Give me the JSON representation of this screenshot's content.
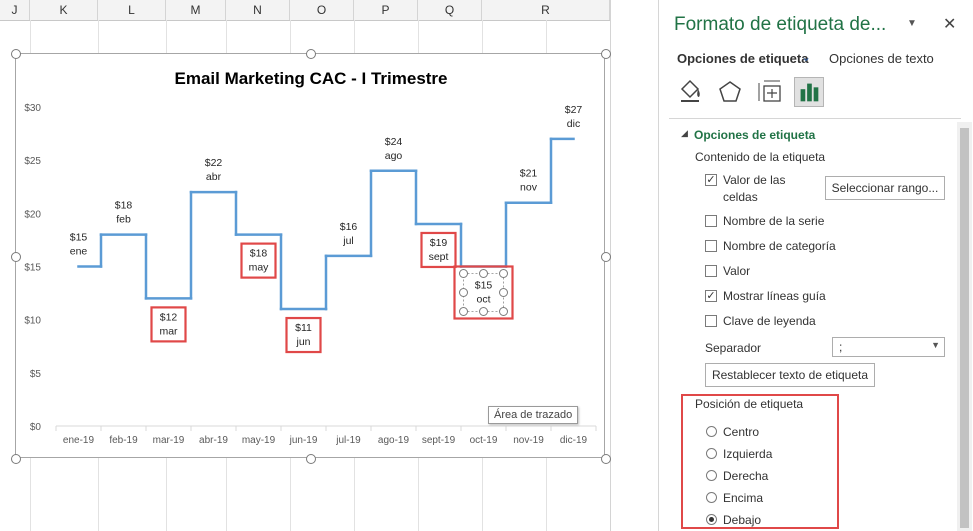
{
  "sheet": {
    "columns": [
      "J",
      "K",
      "L",
      "M",
      "N",
      "O",
      "P",
      "Q",
      "R"
    ]
  },
  "tooltip": "Área de trazado",
  "chart_data": {
    "type": "line",
    "title": "Email Marketing CAC - I Trimestre",
    "categories": [
      "ene-19",
      "feb-19",
      "mar-19",
      "abr-19",
      "may-19",
      "jun-19",
      "jul-19",
      "ago-19",
      "sept-19",
      "oct-19",
      "nov-19",
      "dic-19"
    ],
    "values": [
      15,
      18,
      12,
      22,
      18,
      11,
      16,
      24,
      19,
      15,
      21,
      27
    ],
    "data_labels": [
      {
        "value": "$15",
        "name": "ene"
      },
      {
        "value": "$18",
        "name": "feb"
      },
      {
        "value": "$12",
        "name": "mar"
      },
      {
        "value": "$22",
        "name": "abr"
      },
      {
        "value": "$18",
        "name": "may"
      },
      {
        "value": "$11",
        "name": "jun"
      },
      {
        "value": "$16",
        "name": "jul"
      },
      {
        "value": "$24",
        "name": "ago"
      },
      {
        "value": "$19",
        "name": "sept"
      },
      {
        "value": "$15",
        "name": "oct"
      },
      {
        "value": "$21",
        "name": "nov"
      },
      {
        "value": "$27",
        "name": "dic"
      }
    ],
    "boxed_labels": [
      2,
      4,
      5,
      8,
      9
    ],
    "selected_label": 9,
    "step": true,
    "yticks": [
      "$0",
      "$5",
      "$10",
      "$15",
      "$20",
      "$25",
      "$30"
    ],
    "ylim": [
      0,
      30
    ],
    "grid": false,
    "line_color": "#5b9bd5",
    "highlight_color": "#e04848"
  },
  "pane": {
    "title": "Formato de etiqueta de...",
    "dropdown_icon": "chevron-down-icon",
    "close_icon": "close-icon",
    "tabs": {
      "label_options": "Opciones de etiqueta",
      "text_options": "Opciones de texto"
    },
    "icons": [
      "fill-line-icon",
      "effects-icon",
      "size-properties-icon",
      "label-options-icon"
    ],
    "section_title": "Opciones de etiqueta",
    "content_title": "Contenido de la etiqueta",
    "checkboxes": [
      {
        "label": "Valor de las",
        "checked": true
      },
      {
        "label": "celdas",
        "checked": null
      },
      {
        "label": "Nombre de la serie",
        "checked": false
      },
      {
        "label": "Nombre de categoría",
        "checked": false
      },
      {
        "label": "Valor",
        "checked": false
      },
      {
        "label": "Mostrar líneas guía",
        "checked": true
      },
      {
        "label": "Clave de leyenda",
        "checked": false
      }
    ],
    "select_range_button": "Seleccionar rango...",
    "separator_label": "Separador",
    "separator_value": ";",
    "reset_button": "Restablecer texto de etiqueta",
    "position_title": "Posición de etiqueta",
    "positions": [
      {
        "label": "Centro",
        "selected": false
      },
      {
        "label": "Izquierda",
        "selected": false
      },
      {
        "label": "Derecha",
        "selected": false
      },
      {
        "label": "Encima",
        "selected": false
      },
      {
        "label": "Debajo",
        "selected": true
      }
    ],
    "accent": "#217346"
  }
}
